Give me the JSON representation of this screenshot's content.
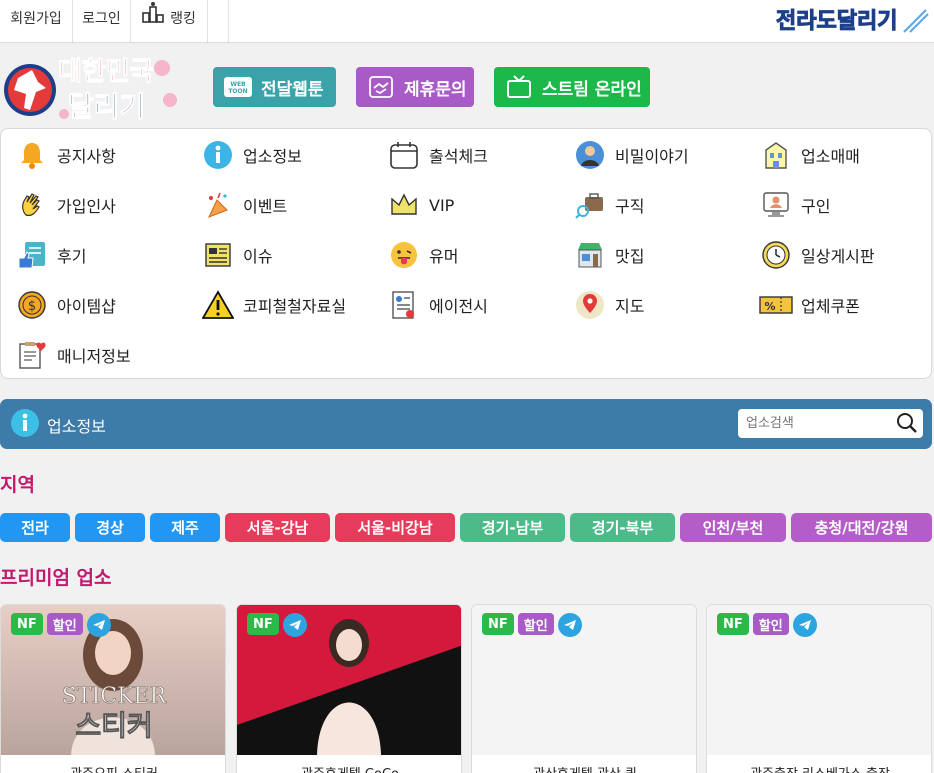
{
  "topbar": {
    "signup": "회원가입",
    "login": "로그인",
    "ranking": "랭킹",
    "site_brand_text": "전라도달리기"
  },
  "header": {
    "logo_text_line1": "대한민국",
    "logo_text_line2": "달리기",
    "buttons": [
      {
        "label": "전달웹툰",
        "icon": "webtoon-icon",
        "color": "#3aa3a9"
      },
      {
        "label": "제휴문의",
        "icon": "handshake-icon",
        "color": "#a85ac6"
      },
      {
        "label": "스트림 온라인",
        "icon": "tv-icon",
        "color": "#1db84a"
      }
    ]
  },
  "menu": {
    "items": [
      {
        "label": "공지사항",
        "icon": "bell-icon"
      },
      {
        "label": "업소정보",
        "icon": "info-icon"
      },
      {
        "label": "출석체크",
        "icon": "calendar-icon"
      },
      {
        "label": "비밀이야기",
        "icon": "person-icon"
      },
      {
        "label": "업소매매",
        "icon": "building-icon"
      },
      {
        "label": "가입인사",
        "icon": "wave-hand-icon"
      },
      {
        "label": "이벤트",
        "icon": "party-popper-icon"
      },
      {
        "label": "VIP",
        "icon": "crown-icon"
      },
      {
        "label": "구직",
        "icon": "briefcase-search-icon"
      },
      {
        "label": "구인",
        "icon": "monitor-person-icon"
      },
      {
        "label": "후기",
        "icon": "review-thumb-icon"
      },
      {
        "label": "이슈",
        "icon": "newspaper-icon"
      },
      {
        "label": "유머",
        "icon": "tongue-emoji-icon"
      },
      {
        "label": "맛집",
        "icon": "store-icon"
      },
      {
        "label": "일상게시판",
        "icon": "clock-icon"
      },
      {
        "label": "아이템샵",
        "icon": "dollar-coin-icon"
      },
      {
        "label": "코피철철자료실",
        "icon": "warning-icon"
      },
      {
        "label": "에이전시",
        "icon": "document-person-icon"
      },
      {
        "label": "지도",
        "icon": "map-pin-icon"
      },
      {
        "label": "업체쿠폰",
        "icon": "coupon-icon"
      },
      {
        "label": "매니저정보",
        "icon": "clipboard-heart-icon"
      }
    ]
  },
  "section": {
    "title": "업소정보",
    "search_placeholder": "업소검색"
  },
  "region": {
    "heading": "지역",
    "buttons": [
      {
        "label": "전라",
        "color": "#2196f3"
      },
      {
        "label": "경상",
        "color": "#2196f3"
      },
      {
        "label": "제주",
        "color": "#2196f3"
      },
      {
        "label": "서울-강남",
        "color": "#e63b5a"
      },
      {
        "label": "서울-비강남",
        "color": "#e63b5a"
      },
      {
        "label": "경기-남부",
        "color": "#4dbb89"
      },
      {
        "label": "경기-북부",
        "color": "#4dbb89"
      },
      {
        "label": "인천/부천",
        "color": "#b45cc8"
      },
      {
        "label": "충청/대전/강원",
        "color": "#b45cc8"
      }
    ]
  },
  "premium": {
    "heading": "프리미엄 업소",
    "badge_nf": "NF",
    "badge_sale": "할인",
    "cards": [
      {
        "name": "광주오피 스티커",
        "image_text": "STICKER",
        "image_text2": "스티커",
        "has_sale": true
      },
      {
        "name": "광주휴게텔 CoCo",
        "image_text": "",
        "image_text2": "",
        "has_sale": false
      },
      {
        "name": "광산휴게텔 광산 퀸",
        "image_text": "",
        "image_text2": "",
        "has_sale": true
      },
      {
        "name": "광주출장 리스베가스 출장",
        "image_text": "",
        "image_text2": "",
        "has_sale": true
      }
    ]
  }
}
